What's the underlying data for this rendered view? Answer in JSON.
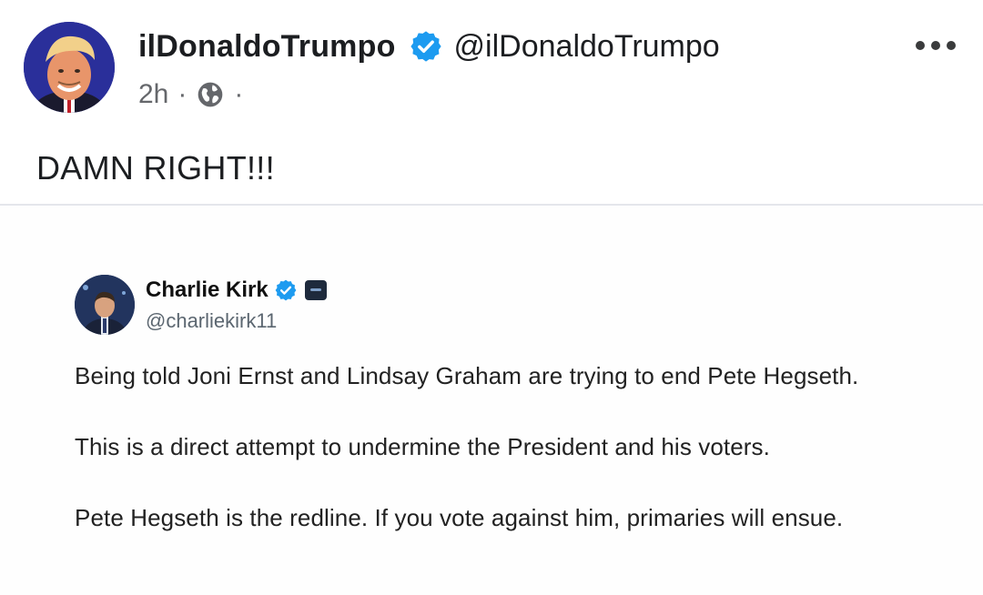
{
  "post": {
    "author_name": "ilDonaldoTrumpo",
    "author_handle": "@ilDonaldoTrumpo",
    "time_ago": "2h",
    "separator": "·",
    "visibility_icon": "globe-icon",
    "more_icon": "more-options-icon",
    "text": "DAMN RIGHT!!!"
  },
  "embedded_tweet": {
    "author_name": "Charlie Kirk",
    "author_handle": "@charliekirk11",
    "paragraphs": [
      "Being told Joni Ernst and Lindsay Graham are trying to end Pete Hegseth.",
      "This is a direct attempt to undermine the President and his voters.",
      "Pete Hegseth is the redline. If you vote against him, primaries will ensue."
    ]
  },
  "colors": {
    "verified_badge": "#1d9bf0",
    "text_primary": "#1c1e21",
    "text_secondary": "#65676b",
    "divider": "#e4e6eb"
  }
}
